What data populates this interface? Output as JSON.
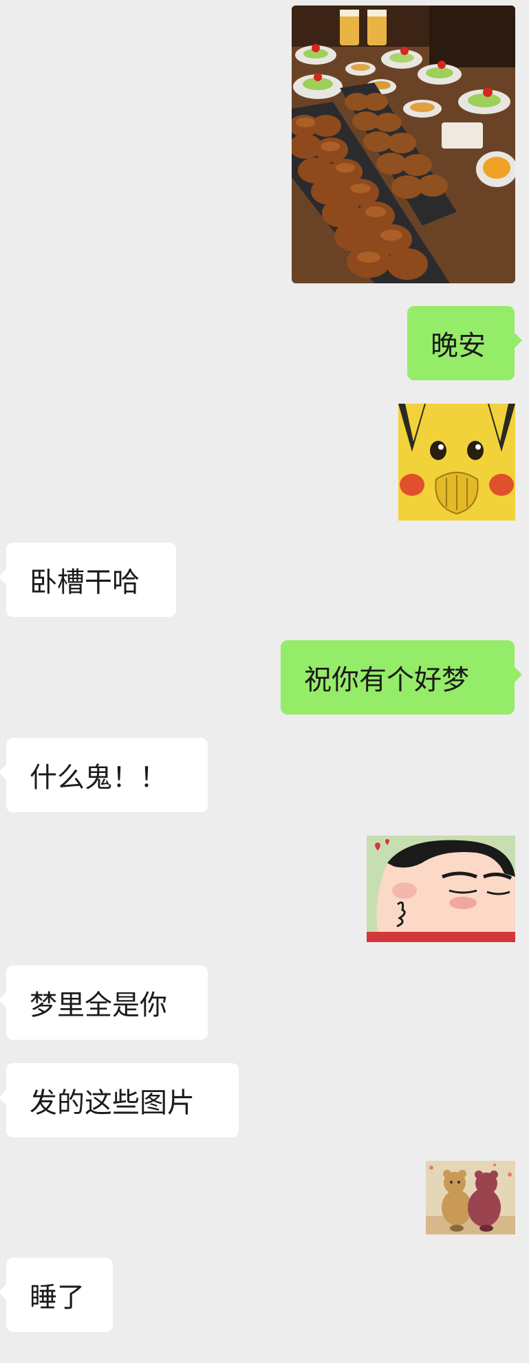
{
  "messages": [
    {
      "side": "right",
      "type": "image",
      "name": "food-photo",
      "description": "photo"
    },
    {
      "side": "right",
      "type": "text",
      "text": "晚安"
    },
    {
      "side": "right",
      "type": "sticker",
      "name": "pikachu-sticker"
    },
    {
      "side": "left",
      "type": "text",
      "text": "卧槽干哈"
    },
    {
      "side": "right",
      "type": "text",
      "text": "祝你有个好梦"
    },
    {
      "side": "left",
      "type": "text",
      "text": "什么鬼！！"
    },
    {
      "side": "right",
      "type": "sticker",
      "name": "crayon-shin-kiss-sticker"
    },
    {
      "side": "left",
      "type": "text",
      "text": "梦里全是你"
    },
    {
      "side": "left",
      "type": "text",
      "text": "发的这些图片"
    },
    {
      "side": "right",
      "type": "sticker",
      "name": "bears-sticker"
    },
    {
      "side": "left",
      "type": "text",
      "text": "睡了"
    }
  ],
  "colors": {
    "background": "#ededed",
    "sent_bubble": "#95ec69",
    "received_bubble": "#ffffff",
    "text": "#1b1b1b"
  }
}
